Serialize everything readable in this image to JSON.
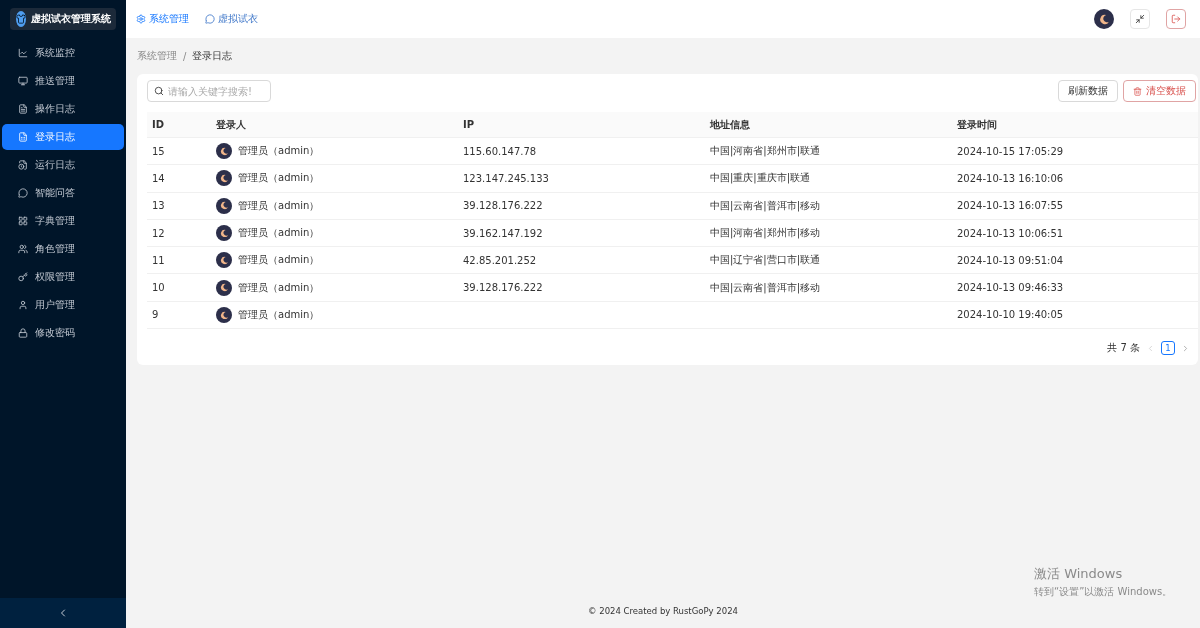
{
  "sidebar": {
    "title": "虚拟试衣管理系统",
    "items": [
      {
        "label": "系统监控",
        "selected": false
      },
      {
        "label": "推送管理",
        "selected": false
      },
      {
        "label": "操作日志",
        "selected": false
      },
      {
        "label": "登录日志",
        "selected": true
      },
      {
        "label": "运行日志",
        "selected": false
      },
      {
        "label": "智能问答",
        "selected": false
      },
      {
        "label": "字典管理",
        "selected": false
      },
      {
        "label": "角色管理",
        "selected": false
      },
      {
        "label": "权限管理",
        "selected": false
      },
      {
        "label": "用户管理",
        "selected": false
      },
      {
        "label": "修改密码",
        "selected": false
      }
    ]
  },
  "topnav": [
    {
      "label": "系统管理",
      "selected": true
    },
    {
      "label": "虚拟试衣",
      "selected": false
    }
  ],
  "breadcrumb": {
    "separator": "/",
    "items": [
      "系统管理",
      "登录日志"
    ]
  },
  "search": {
    "placeholder": "请输入关键字搜索!"
  },
  "buttons": [
    {
      "label": "刷新数据",
      "kind": "plain"
    },
    {
      "label": "清空数据",
      "kind": "danger"
    }
  ],
  "table": {
    "columns": [
      "ID",
      "登录人",
      "IP",
      "地址信息",
      "登录时间"
    ],
    "rows": [
      [
        "15",
        "管理员（admin）",
        "115.60.147.78",
        "中国|河南省|郑州市|联通",
        "2024-10-15 17:05:29"
      ],
      [
        "14",
        "管理员（admin）",
        "123.147.245.133",
        "中国|重庆|重庆市|联通",
        "2024-10-13 16:10:06"
      ],
      [
        "13",
        "管理员（admin）",
        "39.128.176.222",
        "中国|云南省|普洱市|移动",
        "2024-10-13 16:07:55"
      ],
      [
        "12",
        "管理员（admin）",
        "39.162.147.192",
        "中国|河南省|郑州市|移动",
        "2024-10-13 10:06:51"
      ],
      [
        "11",
        "管理员（admin）",
        "42.85.201.252",
        "中国|辽宁省|营口市|联通",
        "2024-10-13 09:51:04"
      ],
      [
        "10",
        "管理员（admin）",
        "39.128.176.222",
        "中国|云南省|普洱市|移动",
        "2024-10-13 09:46:33"
      ],
      [
        "9",
        "管理员（admin）",
        "",
        "",
        "2024-10-10 19:40:05"
      ]
    ]
  },
  "pagination": {
    "total": "共 7 条",
    "pages": [
      {
        "label": "1",
        "selected": true
      }
    ]
  },
  "footer": "© 2024 Created by RustGoPy 2024",
  "os_notice": {
    "title": "激活 Windows",
    "text": "转到“设置”以激活 Windows。"
  }
}
